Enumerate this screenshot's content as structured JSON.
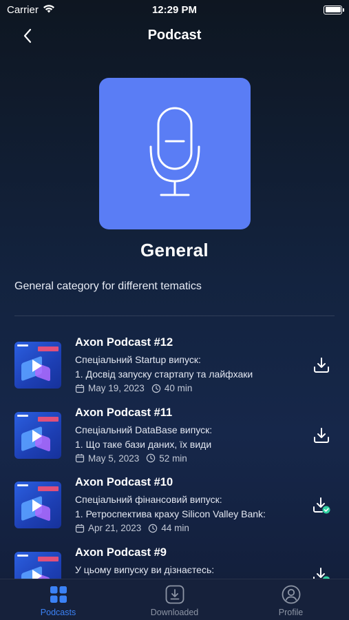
{
  "status_bar": {
    "carrier": "Carrier",
    "time": "12:29 PM"
  },
  "nav": {
    "title": "Podcast"
  },
  "category": {
    "cover_icon": "microphone-icon",
    "cover_color": "#5a7df5",
    "title": "General",
    "description": "General category for different tematics"
  },
  "episodes": [
    {
      "title": "Axon Podcast #12",
      "line1": "Спеціальний Startup випуск:",
      "line2": "1. Досвід запуску стартапу та лайфхаки",
      "date": "May 19, 2023",
      "duration": "40 min",
      "downloaded": false
    },
    {
      "title": "Axon Podcast #11",
      "line1": "Спеціальний DataBase випуск:",
      "line2": "1. Що таке бази даних, їх види",
      "date": "May 5, 2023",
      "duration": "52 min",
      "downloaded": false
    },
    {
      "title": "Axon Podcast #10",
      "line1": "Спеціальний фінансовий випуск:",
      "line2": "1. Ретроспектива краху Silicon Valley Bank:",
      "date": "Apr 21, 2023",
      "duration": "44 min",
      "downloaded": true
    },
    {
      "title": "Axon Podcast #9",
      "line1": "У цьому випуску ви дізнаєтесь:",
      "line2": "",
      "date": "",
      "duration": "",
      "downloaded": true
    }
  ],
  "tabbar": {
    "accent_color": "#3b82f6",
    "tabs": [
      {
        "label": "Podcasts",
        "icon": "grid-icon",
        "active": true
      },
      {
        "label": "Downloaded",
        "icon": "download-box-icon",
        "active": false
      },
      {
        "label": "Profile",
        "icon": "profile-icon",
        "active": false
      }
    ]
  }
}
